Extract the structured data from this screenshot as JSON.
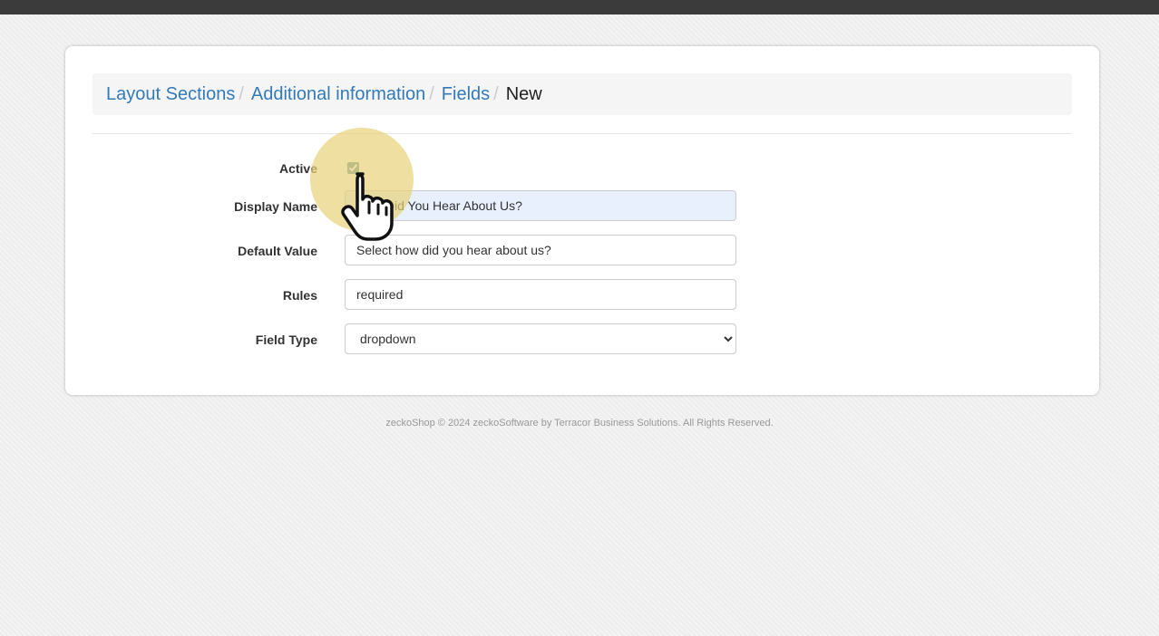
{
  "breadcrumb": {
    "items": [
      {
        "label": "Layout Sections"
      },
      {
        "label": "Additional information"
      },
      {
        "label": "Fields"
      }
    ],
    "separator": "/",
    "current": "New"
  },
  "form": {
    "active": {
      "label": "Active",
      "checked": true
    },
    "display_name": {
      "label": "Display Name",
      "value": "How Did You Hear About Us?"
    },
    "default_value": {
      "label": "Default Value",
      "value": "Select how did you hear about us?"
    },
    "rules": {
      "label": "Rules",
      "value": "required"
    },
    "field_type": {
      "label": "Field Type",
      "selected": "dropdown"
    }
  },
  "footer": {
    "text": "zeckoShop © 2024 zeckoSoftware by Terracor Business Solutions. All Rights Reserved."
  },
  "colors": {
    "link": "#337ab7",
    "topbar": "#3b3b3b",
    "autofill": "#e8f0fe",
    "click_highlight": "#e8d278"
  }
}
